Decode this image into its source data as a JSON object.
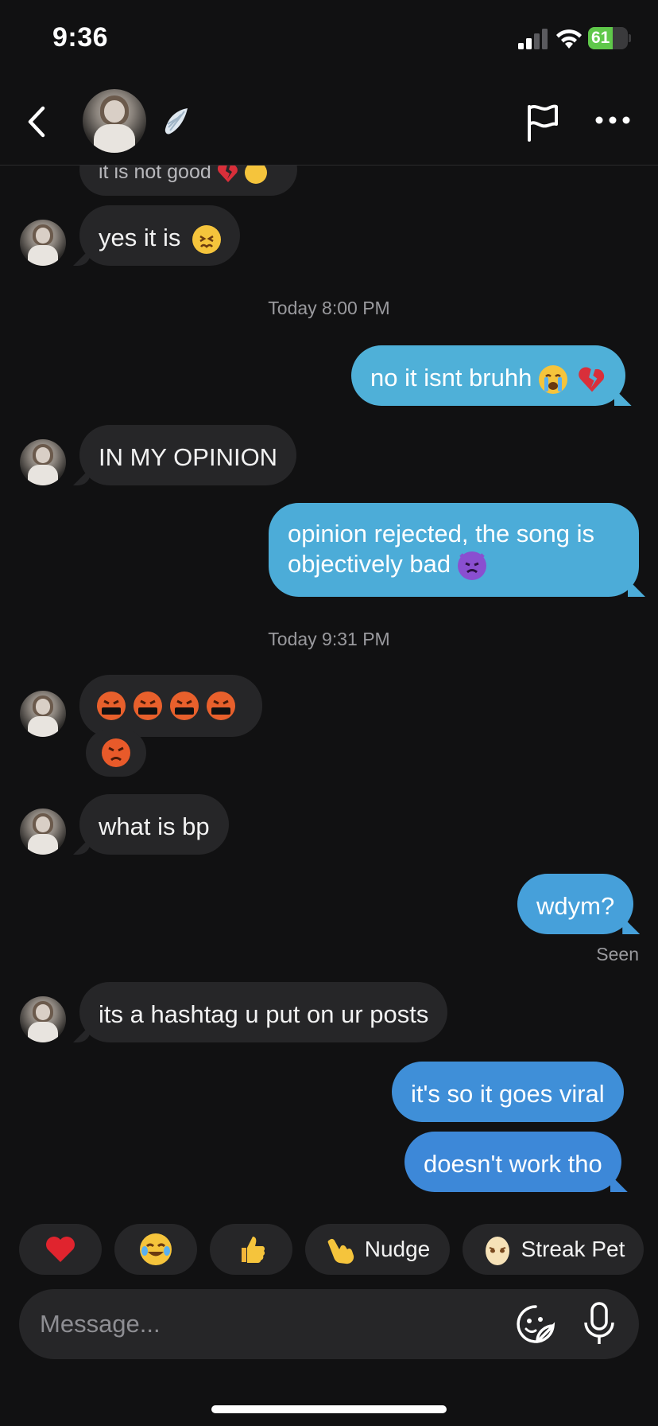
{
  "status_bar": {
    "time": "9:36",
    "battery": "61",
    "battery_level": 0.61
  },
  "header": {
    "back_icon": "chevron-left-icon",
    "wing_icon": "angel-wing-icon",
    "flag_icon": "flag-icon",
    "more_icon": "more-horizontal-icon"
  },
  "messages": {
    "partial": "it is not good",
    "m1": "yes it is",
    "ts1": "Today 8:00 PM",
    "m2": "no it isnt bruhh",
    "m3": "IN MY OPINION",
    "m4_line1": "opinion rejected, the song is",
    "m4_line2": "objectively bad",
    "ts2": "Today 9:31 PM",
    "m5_emojis": "cursing-face ×4",
    "m6_emoji": "angry-face",
    "m7": "what is bp",
    "m8": "wdym?",
    "seen": "Seen",
    "m9": "its a hashtag u put on ur posts",
    "m10": "it's so it goes viral",
    "m11": "doesn't work tho"
  },
  "reactions": {
    "nudge": "Nudge",
    "streak_pet": "Streak Pet"
  },
  "composer": {
    "placeholder": "Message..."
  },
  "colors": {
    "background": "#111112",
    "incoming_bubble": "#262628",
    "outgoing_light": "#4fb0d8",
    "outgoing_mid": "#46a0da",
    "outgoing_dark": "#3d88d8"
  }
}
